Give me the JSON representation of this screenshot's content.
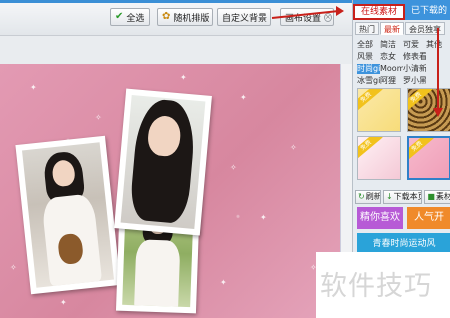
{
  "toolbar": {
    "buttons": [
      {
        "label": "全选",
        "icon": "check-icon"
      },
      {
        "label": "随机排版",
        "icon": "shuffle-icon"
      },
      {
        "label": "自定义背景",
        "icon": "image-icon"
      },
      {
        "label": "画布设置",
        "icon": "settings-icon"
      }
    ]
  },
  "panel": {
    "tabs": [
      {
        "label": "在线素材"
      },
      {
        "label": "已下载的"
      }
    ],
    "subtabs": [
      "热门",
      "最新",
      "会员独享"
    ],
    "categories": [
      "全部",
      "简洁",
      "可爱",
      "其他",
      "风景",
      "恋女",
      "修表看",
      "",
      "时尚girl",
      "Moomoo",
      "小清新",
      "",
      "冰雪girl",
      "阿狸",
      "罗小黑",
      ""
    ],
    "thumb_ribbon": "免费",
    "actions": [
      {
        "label": "刷新",
        "icon": "refresh-icon"
      },
      {
        "label": "下载本页",
        "icon": "download-icon"
      },
      {
        "label": "素材",
        "icon": "material-icon"
      }
    ],
    "tags": [
      "精你喜欢",
      "人气开",
      "青春时尚运动风"
    ]
  },
  "watermark": "软件技巧",
  "colors": {
    "accent": "#3d93dc",
    "callout": "#c8201a",
    "canvas": "#df96ae"
  }
}
